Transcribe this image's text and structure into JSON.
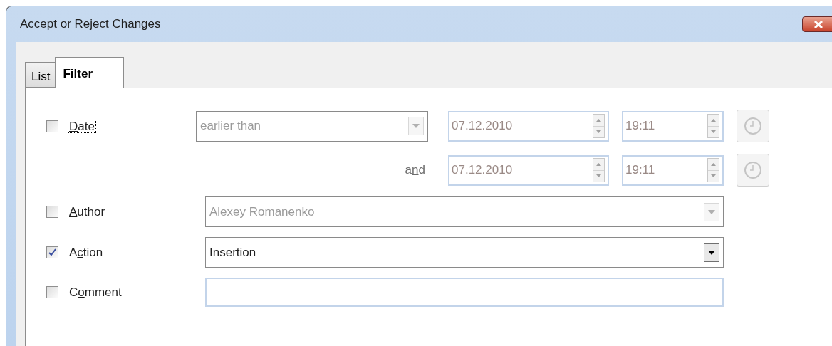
{
  "window": {
    "title": "Accept or Reject Changes"
  },
  "tabs": [
    {
      "label": "List",
      "selected": false
    },
    {
      "label": "Filter",
      "selected": true
    }
  ],
  "filters": [
    {
      "kind": "date",
      "checked": false,
      "focused": true,
      "label": {
        "key": "D",
        "after": "ate"
      },
      "mode": {
        "value": "earlier than",
        "disabled": true
      },
      "start": {
        "date": "07.12.2010",
        "time": "19:11",
        "disabled": true
      },
      "joiner": {
        "before": "a",
        "key": "n",
        "after": "d"
      },
      "end": {
        "date": "07.12.2010",
        "time": "19:11",
        "disabled": true
      }
    },
    {
      "kind": "combo",
      "checked": false,
      "focused": false,
      "label": {
        "key": "A",
        "after": "uthor"
      },
      "value": "Alexey Romanenko",
      "disabled": true
    },
    {
      "kind": "combo",
      "checked": true,
      "focused": false,
      "label": {
        "before": "A",
        "key": "c",
        "after": "tion"
      },
      "value": "Insertion",
      "disabled": false
    },
    {
      "kind": "text",
      "checked": false,
      "focused": false,
      "label": {
        "before": "C",
        "key": "o",
        "after": "mment"
      }
    }
  ]
}
